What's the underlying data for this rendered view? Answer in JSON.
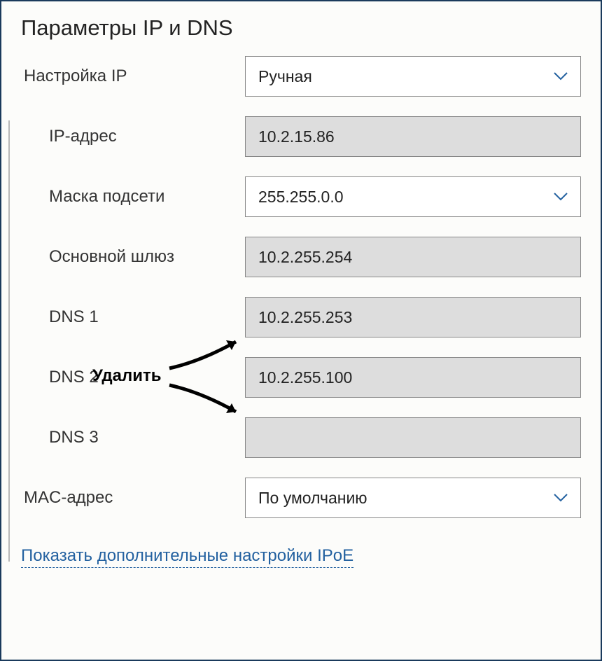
{
  "section_title": "Параметры IP и DNS",
  "ip_config_label": "Настройка IP",
  "ip_config_value": "Ручная",
  "ip_address_label": "IP-адрес",
  "ip_address_value": "10.2.15.86",
  "subnet_label": "Маска подсети",
  "subnet_value": "255.255.0.0",
  "gateway_label": "Основной шлюз",
  "gateway_value": "10.2.255.254",
  "dns1_label": "DNS 1",
  "dns1_value": "10.2.255.253",
  "dns2_label": "DNS 2",
  "dns2_value": "10.2.255.100",
  "dns3_label": "DNS 3",
  "dns3_value": "",
  "mac_label": "MAC-адрес",
  "mac_value": "По умолчанию",
  "footer_link": "Показать дополнительные настройки IPoE",
  "annotation_delete": "Удалить"
}
